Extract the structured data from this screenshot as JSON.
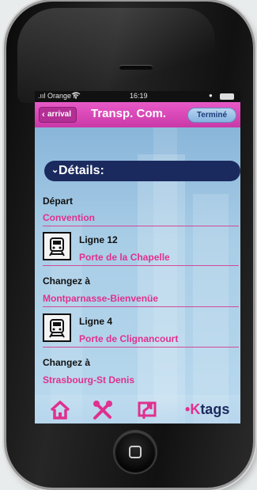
{
  "status": {
    "carrier": ".ııl Orange F",
    "wifi_icon": "wifi-icon",
    "time": "16:19"
  },
  "nav": {
    "back_label": "arrival",
    "title": "Transp. Com.",
    "done_label": "Terminé"
  },
  "section": {
    "title": "Détails:"
  },
  "itinerary": {
    "depart_label": "Départ",
    "depart_station": "Convention",
    "step1_line": "Ligne 12",
    "step1_dest": "Porte de la Chapelle",
    "change1_label": "Changez à",
    "change1_station": "Montparnasse-Bienvenüe",
    "step2_line": "Ligne 4",
    "step2_dest": "Porte de Clignancourt",
    "change2_label": "Changez à",
    "change2_station": "Strasbourg-St Denis"
  },
  "tabbar": {
    "brand_dot": "•",
    "brand_k": "K",
    "brand_rest": "tags",
    "icons": [
      "home-icon",
      "tools-icon",
      "share-icon"
    ]
  },
  "colors": {
    "accent_pink": "#e0308f",
    "navbar_pink": "#d845b8",
    "navy": "#1b2a5e",
    "screen_blue": "#a8cde6"
  }
}
